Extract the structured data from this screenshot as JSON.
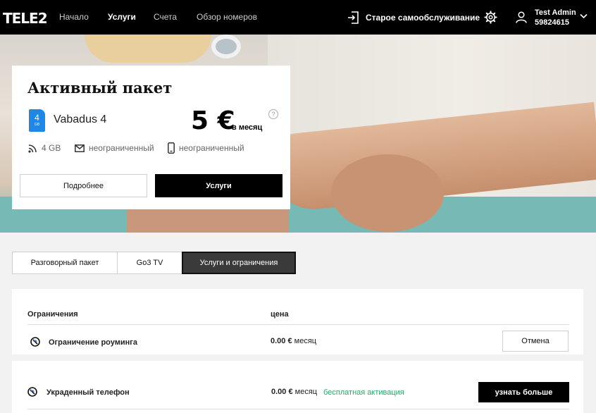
{
  "header": {
    "logo": "TELE2",
    "nav": [
      "Начало",
      "Услуги",
      "Счета",
      "Обзор номеров"
    ],
    "active_nav": "Услуги",
    "old_self_service": "Старое самообслуживание",
    "user_name": "Test Admin",
    "user_number": "59824615"
  },
  "package_card": {
    "title": "Активный пакет",
    "sim_gb": "4",
    "sim_unit": "GB",
    "package_name": "Vabadus 4",
    "price": "5 €",
    "price_period": "в месяц",
    "help_mark": "?",
    "features": {
      "data": "4 GB",
      "sms": "неограниченный",
      "calls": "неограниченный"
    },
    "more_button": "Подробнее",
    "services_button": "Услуги"
  },
  "tabs": [
    "Разговорный пакет",
    "Go3 TV",
    "Услуги и ограничения"
  ],
  "active_tab": "Услуги и ограничения",
  "restrictions": {
    "col_name": "Ограничения",
    "col_price": "цена",
    "rows": [
      {
        "name": "Ограничение роуминга",
        "price": "0.00 €",
        "period": "месяц",
        "action": "Отмена"
      },
      {
        "name": "Украденный телефон",
        "price": "0.00 €",
        "period": "месяц",
        "note": "бесплатная активация",
        "action": "узнать больше"
      }
    ]
  },
  "colors": {
    "accent_black": "#000000",
    "sim_blue": "#1f87e6",
    "free_green": "#2ea56b"
  }
}
